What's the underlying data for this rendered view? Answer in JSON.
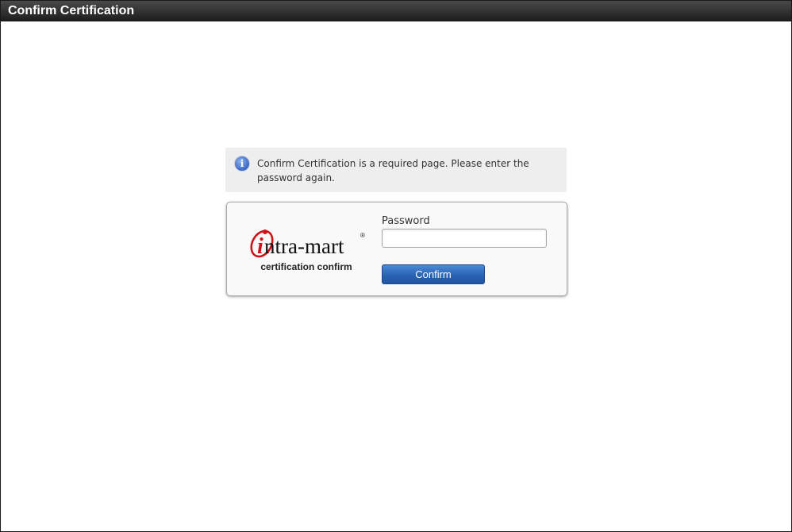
{
  "window": {
    "title": "Confirm Certification"
  },
  "info": {
    "icon": "info-icon",
    "message": "Confirm Certification is a required page. Please enter the password again."
  },
  "logo": {
    "text": "intra-mart",
    "registered_mark": "®",
    "caption": "certification confirm"
  },
  "form": {
    "password_label": "Password",
    "password_value": "",
    "confirm_label": "Confirm"
  },
  "colors": {
    "titlebar": "#2e2e2e",
    "logo_red": "#d0121b",
    "button_blue": "#2a63b4"
  }
}
